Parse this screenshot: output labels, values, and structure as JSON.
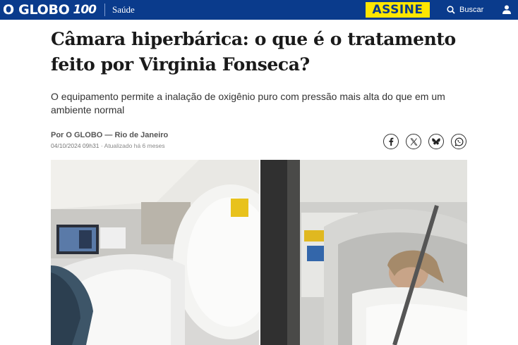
{
  "header": {
    "logo_text": "O GLOBO",
    "logo_anniversary": "100",
    "section": "Saúde",
    "subscribe_label": "ASSINE",
    "search_label": "Buscar",
    "colors": {
      "bar": "#0a3b8c",
      "subscribe_bg": "#ffe600"
    }
  },
  "article": {
    "title_line1": "Câmara hiperbárica: o que é o tratamento",
    "title_line2": "feito por Virginia Fonseca?",
    "subtitle": "O equipamento permite a inalação de oxigênio puro com pressão mais alta do que em um ambiente normal",
    "byline": "Por O GLOBO — Rio de Janeiro",
    "published": "04/10/2024 09h31",
    "updated": "Atualizado há 6 meses"
  },
  "share": {
    "icons": [
      "facebook-icon",
      "x-icon",
      "bluesky-icon",
      "whatsapp-icon"
    ]
  }
}
